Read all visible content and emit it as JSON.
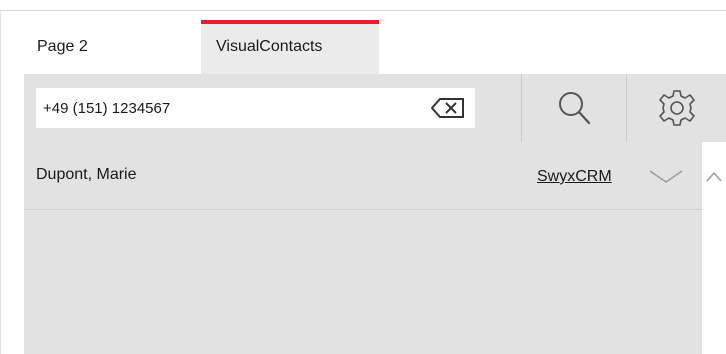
{
  "tabs": [
    {
      "label": "Page 2",
      "active": false
    },
    {
      "label": "VisualContacts",
      "active": true
    }
  ],
  "search": {
    "value": "+49 (151) 1234567",
    "clear_icon": "backspace-clear-icon",
    "search_icon": "search-icon",
    "settings_icon": "gear-icon"
  },
  "results": [
    {
      "name": "Dupont, Marie",
      "source": "SwyxCRM",
      "expand_icon": "chevron-down-icon"
    }
  ],
  "scrollbar": {
    "up_icon": "chevron-up-icon"
  },
  "colors": {
    "accent": "#e81c2b",
    "panel_bg": "#e2e2e2",
    "active_tab_bg": "#ebebeb",
    "text": "#1a1a1a"
  }
}
